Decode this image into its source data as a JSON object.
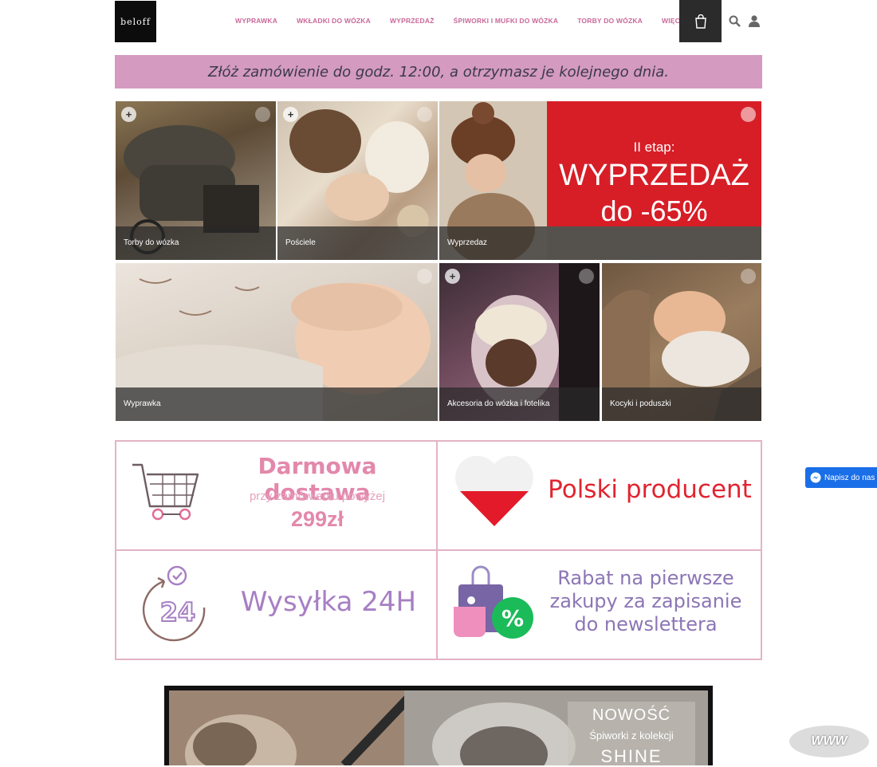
{
  "header": {
    "logo_text": "beloff",
    "nav": [
      "WYPRAWKA",
      "WKŁADKI DO WÓZKA",
      "WYPRZEDAŻ",
      "ŚPIWORKI I MUFKI DO WÓZKA",
      "TORBY DO WÓZKA",
      "WIĘCEJ"
    ],
    "icons": [
      "cart-icon",
      "search-icon",
      "user-icon"
    ]
  },
  "banner": {
    "text": "Złóż zamówienie do godz. 12:00, a otrzymasz je kolejnego dnia."
  },
  "tiles": [
    {
      "caption": "Torby do wózka"
    },
    {
      "caption": "Pościele"
    },
    {
      "caption": "Wyprzedaz"
    },
    {
      "caption": "Wyprawka"
    },
    {
      "caption": "Akcesoria do wózka i fotelika"
    },
    {
      "caption": "Kocyki i poduszki"
    }
  ],
  "sale": {
    "line1": "II etap:",
    "line2": "WYPRZEDAŻ",
    "line3": "do -65%"
  },
  "features": {
    "delivery": {
      "title": "Darmowa dostawa",
      "subtitle": "przy zamówieniu powyżej",
      "amount": "299zł"
    },
    "producer": {
      "title": "Polski producent"
    },
    "shipping": {
      "badge": "24",
      "title": "Wysyłka 24H"
    },
    "discount": {
      "line1": "Rabat na pierwsze",
      "line2": "zakupy za zapisanie",
      "line3": "do newslettera"
    }
  },
  "promo": {
    "line1": "NOWOŚĆ",
    "line2": "Śpiworki z kolekcji",
    "line3": "SHINE"
  },
  "messenger": {
    "label": "Napisz do nas"
  },
  "www_badge": "WWW",
  "colors": {
    "pink": "#d49ac0",
    "accent": "#c9689a",
    "sale_red": "#d71e27",
    "purple": "#a77fc4"
  }
}
